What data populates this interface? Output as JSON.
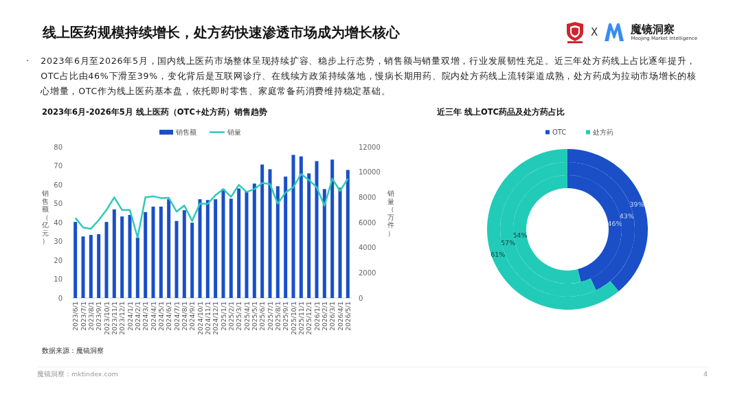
{
  "header": {
    "title": "线上医药规模持续增长，处方药快速渗透市场成为增长核心",
    "partner_separator": "X",
    "brand_name": "魔镜洞察",
    "brand_tagline": "Moojing Market Intelligence"
  },
  "summary": {
    "bullet": "·",
    "text": "2023年6月至2026年5月，国内线上医药市场整体呈现持续扩容、稳步上行态势，销售额与销量双增，行业发展韧性充足。近三年处方药线上占比逐年提升，OTC占比由46%下滑至39%，变化背后是互联网诊疗、在线续方政策持续落地，慢病长期用药、院内处方药线上流转渠道成熟，处方药成为拉动市场增长的核心增量，OTC作为线上医药基本盘，依托即时零售、家庭常备药消费维持稳定基础。"
  },
  "sales_chart": {
    "title": "2023年6月-2026年5月 线上医药（OTC+处方药）销售趋势",
    "chart_data": {
      "type": "bar",
      "ylabel": "销售额（亿元）",
      "ylim": [
        0,
        80
      ],
      "yticks": [
        0,
        10,
        20,
        30,
        40,
        50,
        60,
        70,
        80
      ],
      "legend": true,
      "categories": [
        "2023/6/1",
        "2023/7/1",
        "2023/8/1",
        "2023/9/1",
        "2023/10/1",
        "2023/11/1",
        "2023/12/1",
        "2024/1/1",
        "2024/2/1",
        "2024/3/1",
        "2024/4/1",
        "2024/5/1",
        "2024/6/1",
        "2024/7/1",
        "2024/8/1",
        "2024/9/1",
        "2024/10/1",
        "2024/11/1",
        "2024/12/1",
        "2025/1/1",
        "2025/2/1",
        "2025/3/1",
        "2025/4/1",
        "2025/5/1",
        "2025/6/1",
        "2025/7/1",
        "2025/8/1",
        "2025/9/1",
        "2025/10/1",
        "2025/11/1",
        "2025/12/1",
        "2026/1/1",
        "2026/2/1",
        "2026/3/1",
        "2026/4/1",
        "2026/5/1"
      ],
      "series": [
        {
          "name": "销售额",
          "color": "#1a4fc7",
          "values": [
            40.3,
            32.6,
            33.4,
            33.8,
            40.3,
            46.9,
            43.2,
            44,
            32,
            45.5,
            48.4,
            48.4,
            52.3,
            40.8,
            46.5,
            39.9,
            52.3,
            51.9,
            52.3,
            57.7,
            52.6,
            58,
            56.6,
            60.6,
            70.7,
            68.2,
            59.2,
            64.3,
            75.8,
            75,
            66,
            72.5,
            57.7,
            73.3,
            58.4,
            67.8
          ]
        }
      ]
    },
    "volume_overlay": {
      "chart_data": {
        "type": "line",
        "ylabel": "销量（万件）",
        "ylim": [
          0,
          12000
        ],
        "yticks": [
          0,
          2000,
          4000,
          6000,
          8000,
          10000,
          12000
        ],
        "series": [
          {
            "name": "销量",
            "color": "#2ec9b7",
            "values": [
              6360,
              5600,
              5500,
              6190,
              6990,
              8000,
              6990,
              6990,
              4800,
              8000,
              8080,
              7940,
              7960,
              6860,
              7350,
              6130,
              7500,
              7470,
              8170,
              8650,
              8040,
              8990,
              8420,
              8650,
              9140,
              9050,
              7500,
              8380,
              8800,
              9850,
              9370,
              8800,
              7330,
              9470,
              8510,
              9470
            ]
          }
        ]
      }
    }
  },
  "share_chart": {
    "title": "近三年 线上OTC药品及处方药占比",
    "chart_data": {
      "type": "donut",
      "categories": [
        "OTC",
        "处方药"
      ],
      "colors": [
        "#1a4fc7",
        "#22cbb8"
      ],
      "legend": true,
      "series": [
        {
          "values": [
            46,
            54
          ],
          "value_labels": [
            "46%",
            "54%"
          ]
        },
        {
          "values": [
            43,
            57
          ],
          "value_labels": [
            "43%",
            "57%"
          ]
        },
        {
          "values": [
            39,
            61
          ],
          "value_labels": [
            "39%",
            "61%"
          ]
        }
      ]
    }
  },
  "source": "数据来源：魔镜洞察",
  "footer": {
    "site": "魔镜洞察：mktindex.com",
    "page_number": "4"
  }
}
